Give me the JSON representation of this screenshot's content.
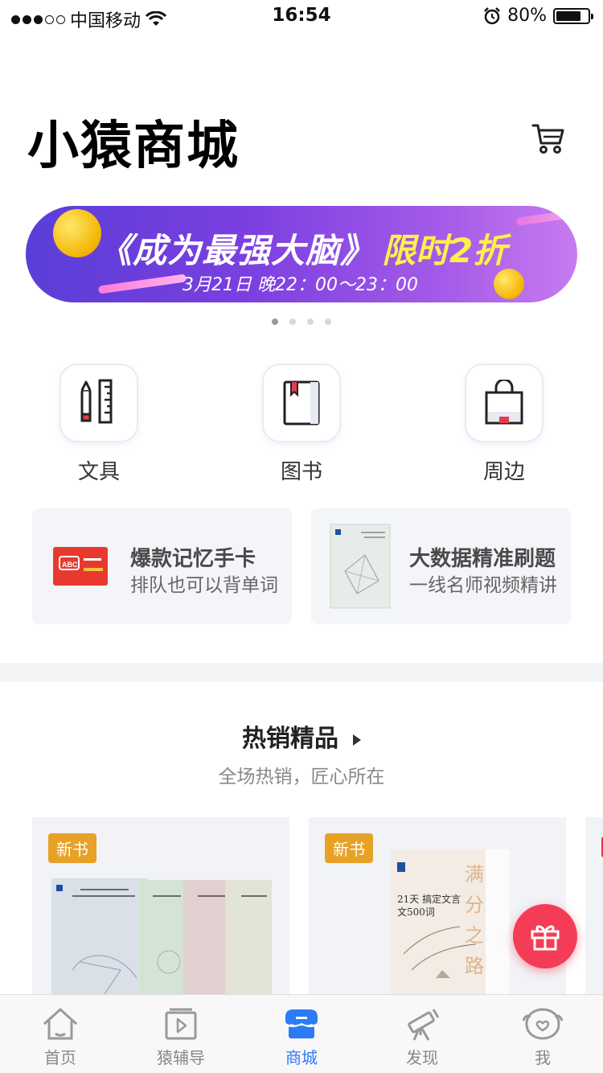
{
  "status_bar": {
    "carrier": "中国移动",
    "time": "16:54",
    "battery": "80%"
  },
  "header": {
    "title": "小猿商城"
  },
  "banner": {
    "title": "《成为最强大脑》",
    "highlight": "限时2折",
    "subtitle": "3月21日 晚22：00～23：00",
    "page_count": 4,
    "active_page": 1
  },
  "categories": [
    {
      "label": "文具",
      "icon": "stationery-icon"
    },
    {
      "label": "图书",
      "icon": "book-icon"
    },
    {
      "label": "周边",
      "icon": "shopping-bag-icon"
    }
  ],
  "promos": [
    {
      "title": "爆款记忆手卡",
      "subtitle": "排队也可以背单词"
    },
    {
      "title": "大数据精准刷题",
      "subtitle": "一线名师视频精讲"
    }
  ],
  "section": {
    "title": "热销精品",
    "subtitle": "全场热销，匠心所在"
  },
  "products": [
    {
      "badge": "新书"
    },
    {
      "badge": "新书",
      "cover_title": "21天 搞定文言文500词",
      "cover_side": "满分之路"
    }
  ],
  "tabs": [
    {
      "label": "首页",
      "icon": "home-icon"
    },
    {
      "label": "猿辅导",
      "icon": "video-play-icon"
    },
    {
      "label": "商城",
      "icon": "store-icon",
      "active": true
    },
    {
      "label": "发现",
      "icon": "telescope-icon"
    },
    {
      "label": "我",
      "icon": "profile-icon"
    }
  ],
  "colors": {
    "accent": "#2c7bf6",
    "badge": "#e7a126",
    "gift": "#f43c56"
  }
}
